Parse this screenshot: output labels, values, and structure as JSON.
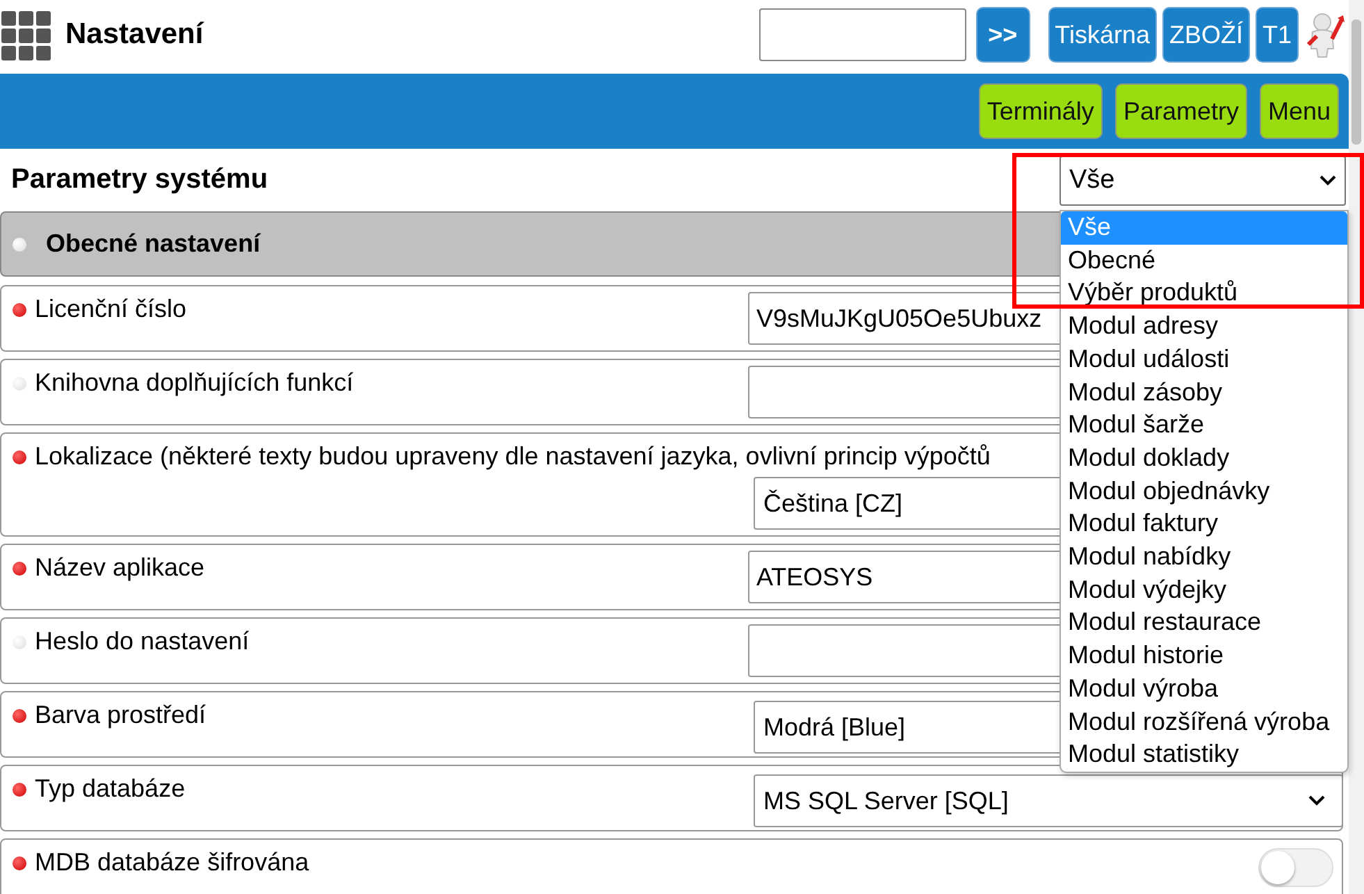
{
  "header": {
    "title": "Nastavení",
    "buttons": [
      ">>",
      "Tiskárna",
      "ZBOŽÍ",
      "T1"
    ]
  },
  "nav_buttons": [
    "Terminály",
    "Parametry",
    "Menu"
  ],
  "section": {
    "title": "Parametry systému",
    "filter": {
      "value": "Vše",
      "expanded": true,
      "options": [
        {
          "label": "Vše",
          "selected": true
        },
        {
          "label": "Obecné",
          "selected": false
        },
        {
          "label": "Výběr produktů",
          "selected": false
        },
        {
          "label": "Modul adresy",
          "selected": false
        },
        {
          "label": "Modul události",
          "selected": false
        },
        {
          "label": "Modul zásoby",
          "selected": false
        },
        {
          "label": "Modul šarže",
          "selected": false
        },
        {
          "label": "Modul doklady",
          "selected": false
        },
        {
          "label": "Modul objednávky",
          "selected": false
        },
        {
          "label": "Modul faktury",
          "selected": false
        },
        {
          "label": "Modul nabídky",
          "selected": false
        },
        {
          "label": "Modul výdejky",
          "selected": false
        },
        {
          "label": "Modul restaurace",
          "selected": false
        },
        {
          "label": "Modul historie",
          "selected": false
        },
        {
          "label": "Modul výroba",
          "selected": false
        },
        {
          "label": "Modul rozšířená výroba",
          "selected": false
        },
        {
          "label": "Modul statistiky",
          "selected": false
        }
      ]
    }
  },
  "group": {
    "title": "Obecné nastavení",
    "required": false
  },
  "settings": [
    {
      "kind": "text",
      "label": "Licenční číslo",
      "required": true,
      "value": "V9sMuJKgU05Oe5Ubuxz"
    },
    {
      "kind": "text",
      "label": "Knihovna doplňujících funkcí",
      "required": false
    },
    {
      "kind": "select",
      "label": "Lokalizace (některé texty budou upraveny dle nastavení jazyka, ovlivní princip výpočtů",
      "required": true,
      "value": "Čeština [CZ]",
      "wide": true
    },
    {
      "kind": "text",
      "label": "Název aplikace",
      "required": true,
      "value": "ATEOSYS"
    },
    {
      "kind": "text",
      "label": "Heslo do nastavení",
      "required": false
    },
    {
      "kind": "select",
      "label": "Barva prostředí",
      "required": true,
      "value": "Modrá [Blue]"
    },
    {
      "kind": "select",
      "label": "Typ databáze",
      "required": true,
      "value": "MS SQL Server [SQL]",
      "arrow_visible": true
    },
    {
      "kind": "toggle",
      "label": "MDB databáze šifrována",
      "required": true,
      "on": false
    }
  ]
}
